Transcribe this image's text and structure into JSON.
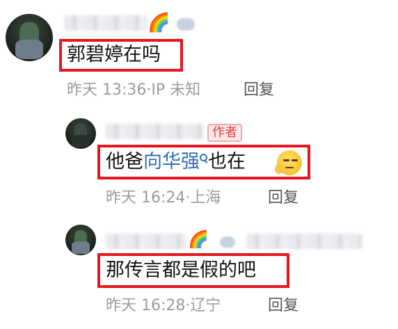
{
  "comments": [
    {
      "text": "郭碧婷在吗",
      "time": "昨天 13:36",
      "location": "IP 未知",
      "reply_label": "回复"
    },
    {
      "author_badge": "作者",
      "text_prefix": "他爸",
      "link_text": "向华强",
      "text_suffix": "也在",
      "time": "昨天 16:24",
      "location": "上海",
      "reply_label": "回复"
    },
    {
      "text": "那传言都是假的吧",
      "time": "昨天 16:28",
      "location": "辽宁",
      "reply_label": "回复"
    }
  ],
  "colors": {
    "highlight_box": "#e6161e",
    "link": "#2f6db7",
    "meta_text": "#9a9aa0",
    "author_badge": "#e53b3b"
  }
}
